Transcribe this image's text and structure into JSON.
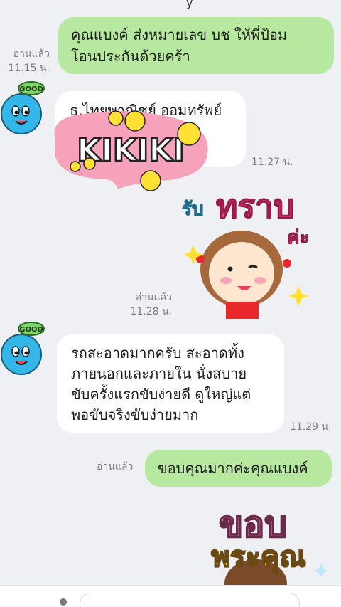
{
  "chat": {
    "messages": [
      {
        "side": "right",
        "text_line1": "คุณแบงค์ ส่งหมายเลข บช ให้พี่ป้อม",
        "text_line2": "โอนประกันด้วยคร้า",
        "read": "อ่านแล้ว",
        "time": "11.15 น."
      },
      {
        "side": "left",
        "text": "ธ.ไทยพาณิชย์ ออมทรัพย์",
        "sticker_text": "KIKIKI",
        "time": "11.27 น."
      },
      {
        "side": "right",
        "sticker_text_top": "รับ",
        "sticker_text_main": "ทราบ",
        "sticker_text_sub": "ค่ะ",
        "read": "อ่านแล้ว",
        "time": "11.28 น."
      },
      {
        "side": "left",
        "line1": "รถสะอาดมากครับ สะอาดทั้ง",
        "line2": "ภายนอกและภายใน นั่งสบาย",
        "line3": "ขับครั้งแรกขับง่ายดี ดูใหญ่แต่",
        "line4": "พอขับจริงขับง่ายมาก",
        "time": "11.29 น."
      },
      {
        "side": "right",
        "text": "ขอบคุณมากค่ะคุณแบงค์",
        "read": "อ่านแล้ว"
      },
      {
        "side": "right",
        "sticker_line1": "ขอบ",
        "sticker_line2": "พระคุณ"
      }
    ],
    "avatar_badge": "GOOD"
  },
  "colors": {
    "background": "#eef0f3",
    "sent_bubble": "#b7e89f",
    "received_bubble": "#ffffff",
    "meta_text": "#7a7e86",
    "avatar": "#34b6e8"
  }
}
